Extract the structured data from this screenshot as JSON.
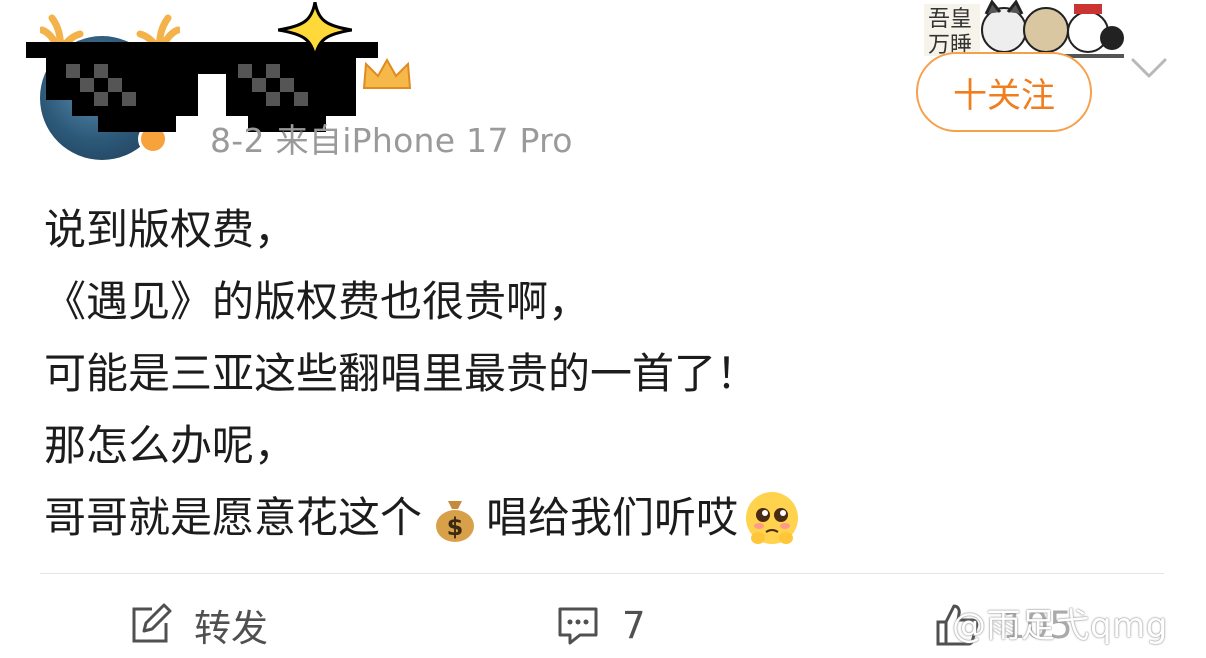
{
  "post_header": {
    "meta_text": "8-2  来自iPhone 17 Pro",
    "follow_label": "十关注",
    "sticker_text": "吾皇万睡"
  },
  "post": {
    "lines": [
      "说到版权费，",
      "《遇见》的版权费也很贵啊，",
      "可能是三亚这些翻唱里最贵的一首了！",
      "那怎么办呢，",
      "哥哥就是愿意花这个",
      "唱给我们听哎"
    ],
    "emoji_money": "money-bag-emoji",
    "emoji_pleading": "pleading-face-emoji"
  },
  "actions": {
    "repost_label": "转发",
    "comment_count": "7",
    "like_count": "105"
  },
  "watermark": "@雨足弋qmg",
  "colors": {
    "accent": "#f07e1e",
    "meta_gray": "#9a9a9a",
    "text": "#1c1c1c"
  }
}
